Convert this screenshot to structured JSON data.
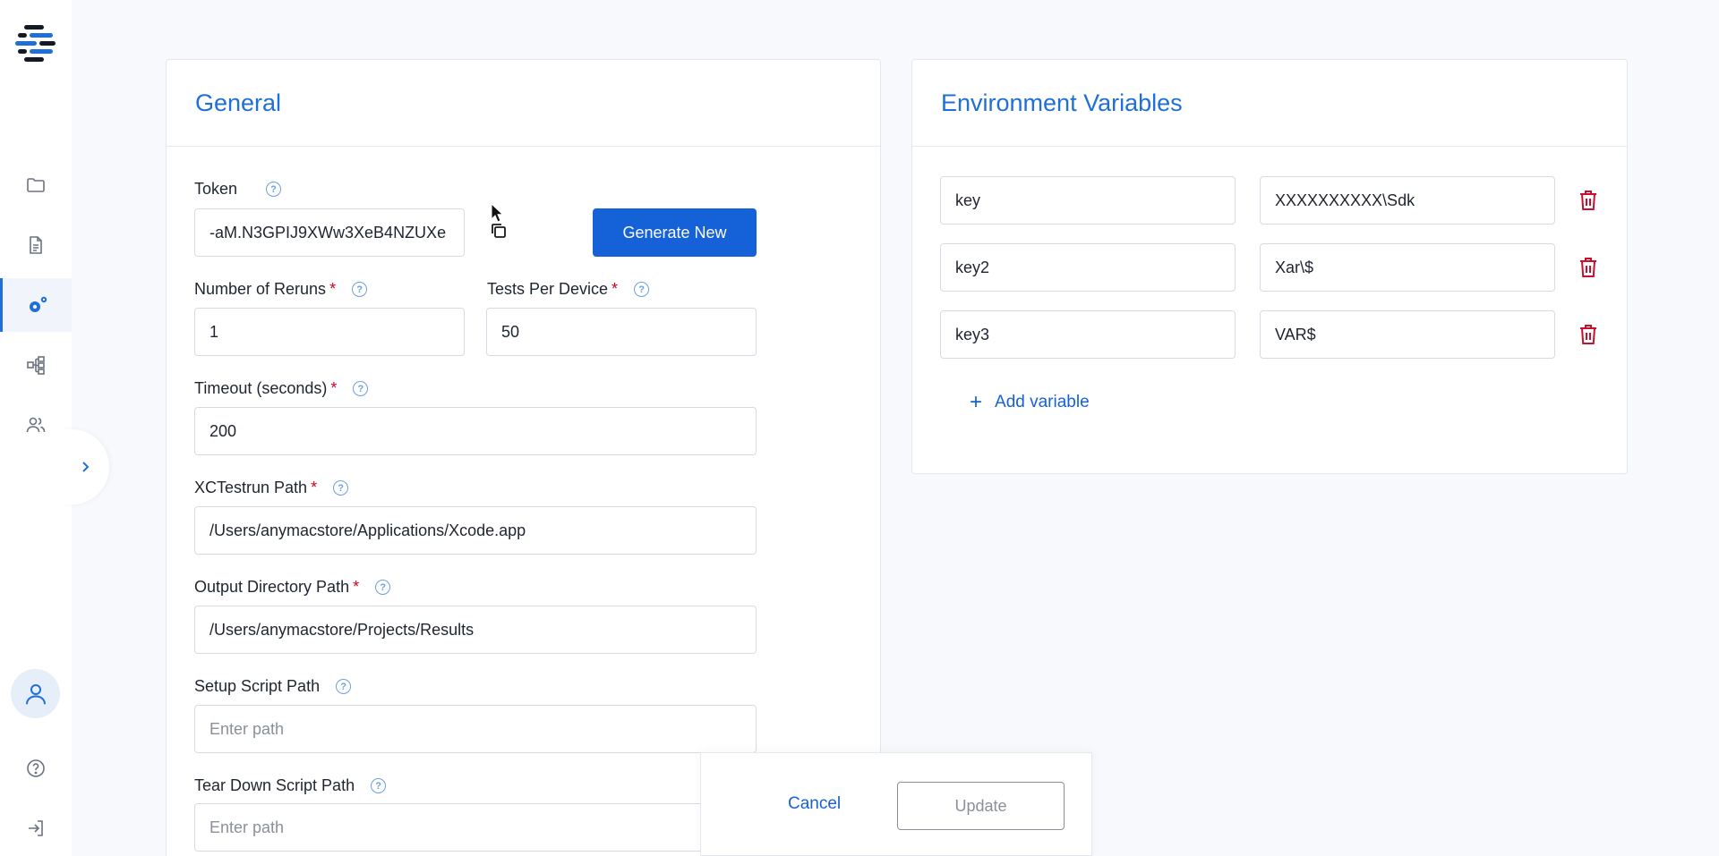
{
  "icons": {
    "logo": "app-logo",
    "nav": [
      "folder-icon",
      "document-icon",
      "gear-icon",
      "workflow-icon",
      "users-icon"
    ],
    "expand": "chevron-right-icon",
    "avatar": "user-icon",
    "help": "help-icon",
    "logout": "logout-icon"
  },
  "colors": {
    "accent": "#1561d8",
    "title": "#1f6fd6",
    "danger": "#c8102e"
  },
  "general": {
    "title": "General",
    "token": {
      "label": "Token",
      "value": "-aM.N3GPIJ9XWw3XeB4NZUXe",
      "generate_label": "Generate New"
    },
    "reruns": {
      "label": "Number of Reruns",
      "value": "1"
    },
    "tests_per_device": {
      "label": "Tests Per Device",
      "value": "50"
    },
    "timeout": {
      "label": "Timeout (seconds)",
      "value": "200"
    },
    "xctestrun": {
      "label": "XCTestrun Path",
      "value": "/Users/anymacstore/Applications/Xcode.app"
    },
    "output_dir": {
      "label": "Output Directory Path",
      "value": "/Users/anymacstore/Projects/Results"
    },
    "setup_script": {
      "label": "Setup Script Path",
      "placeholder": "Enter path"
    },
    "teardown_script": {
      "label": "Tear Down Script Path",
      "placeholder": "Enter path"
    },
    "required_mark": "*",
    "help_glyph": "?"
  },
  "env": {
    "title": "Environment Variables",
    "rows": [
      {
        "key": "key",
        "value": "XXXXXXXXXX\\Sdk"
      },
      {
        "key": "key2",
        "value": "Xar\\$"
      },
      {
        "key": "key3",
        "value": "VAR$"
      }
    ],
    "add_label": "Add variable",
    "add_glyph": "+"
  },
  "actions": {
    "cancel_label": "Cancel",
    "update_label": "Update"
  }
}
